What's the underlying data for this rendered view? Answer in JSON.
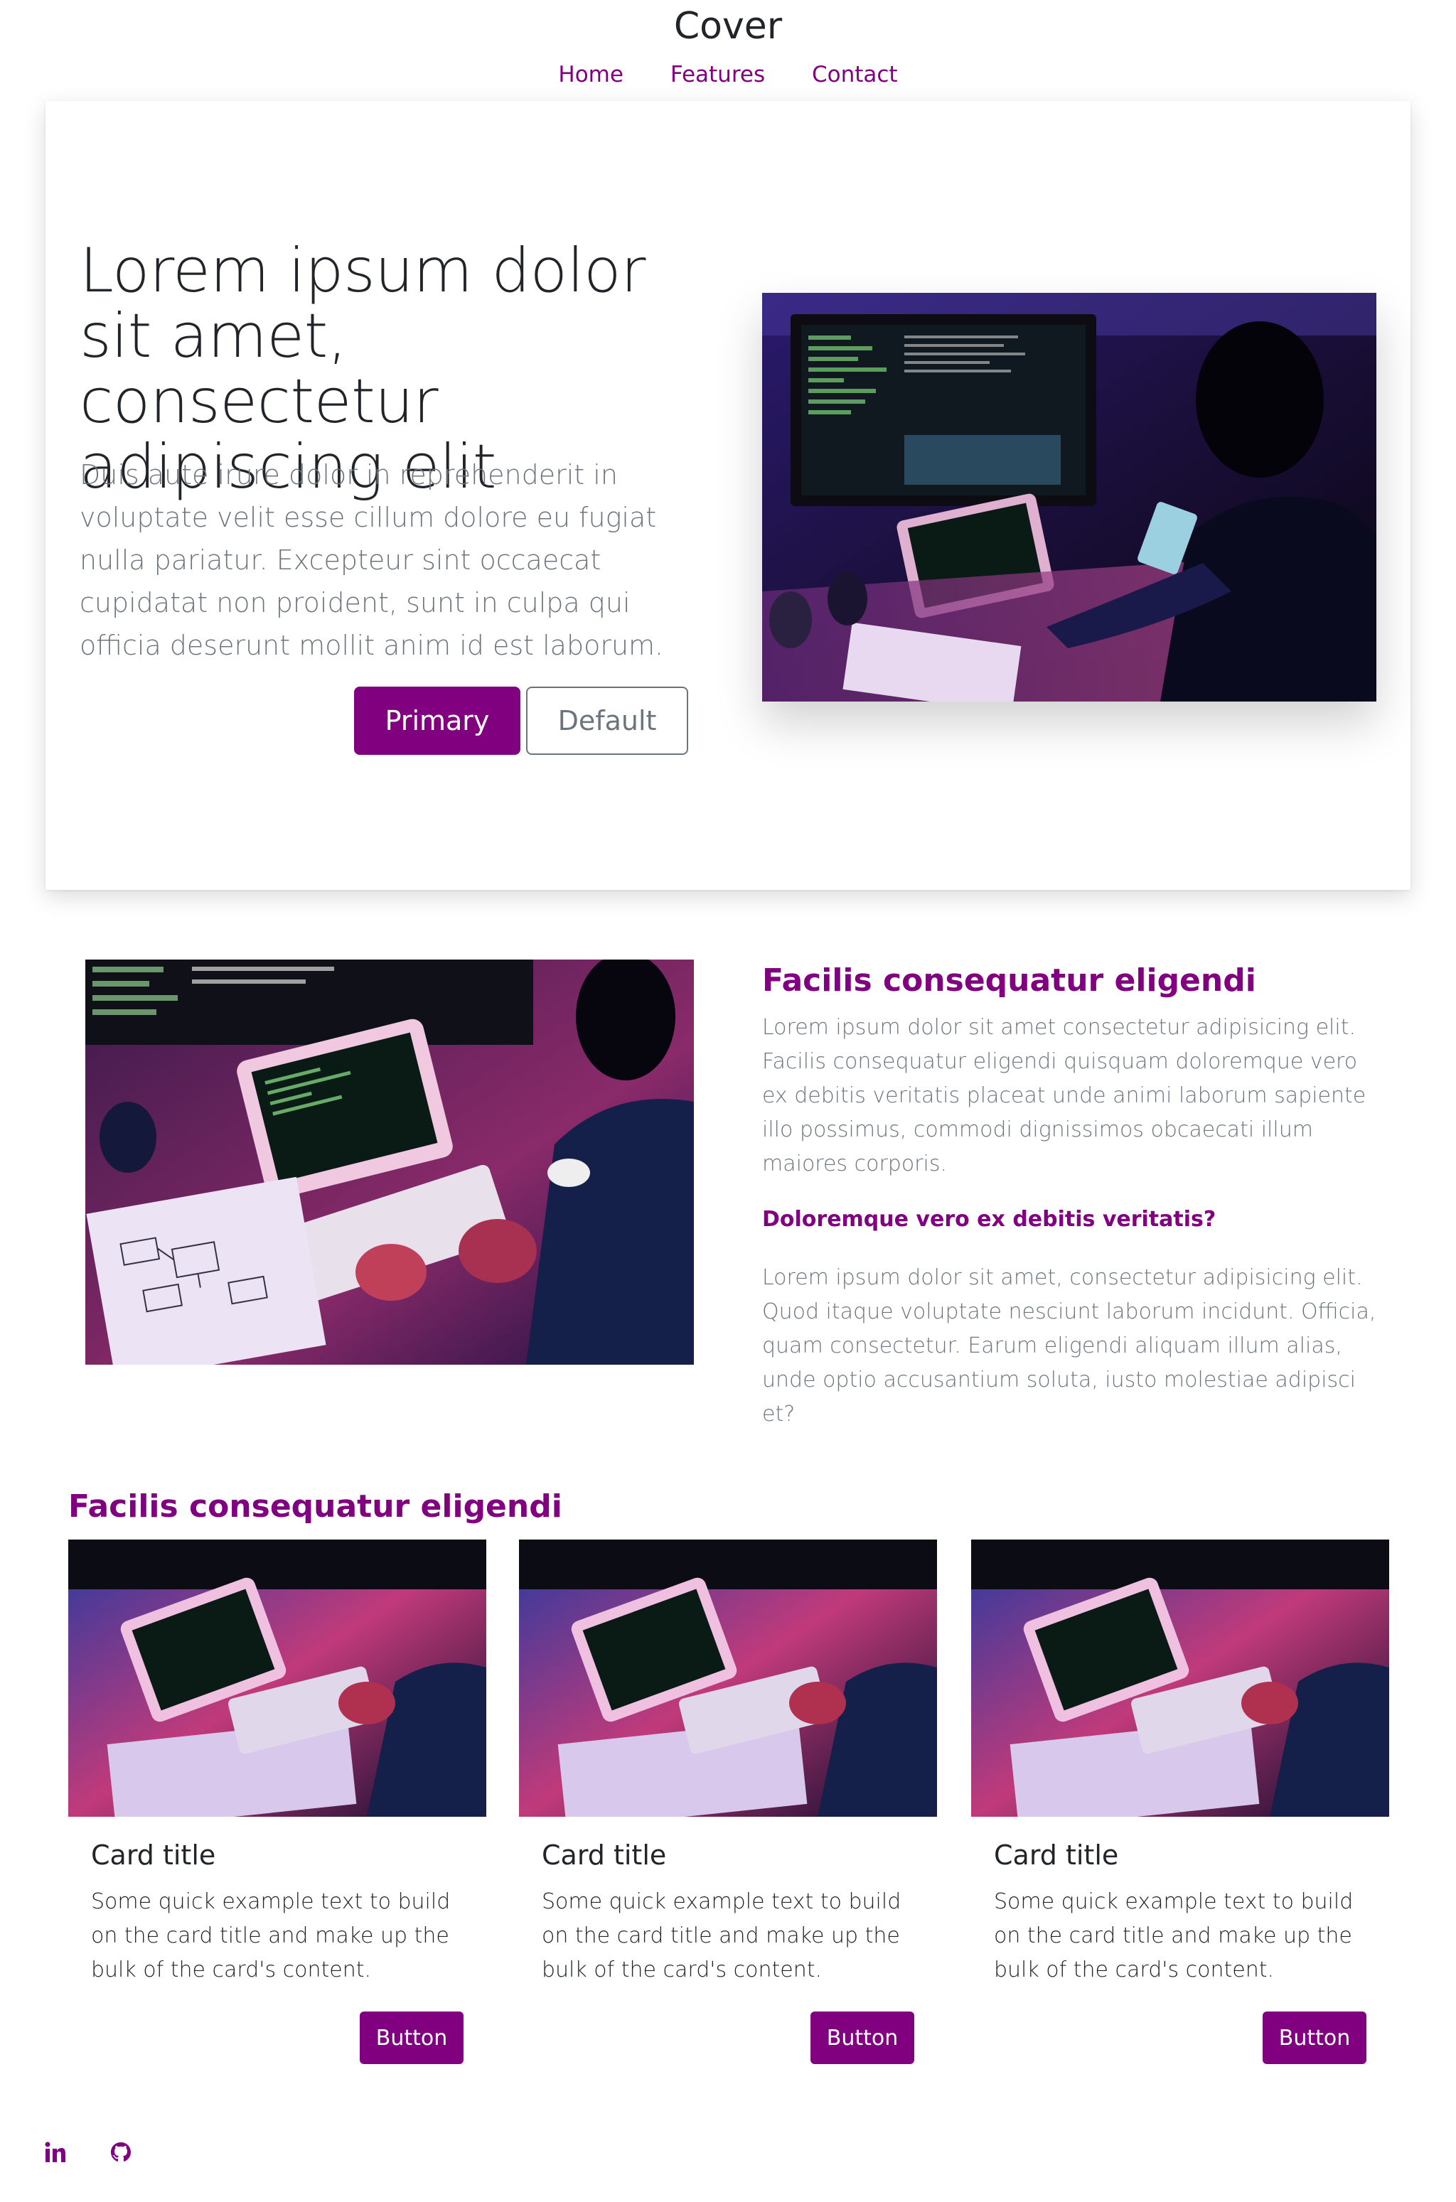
{
  "header": {
    "title": "Cover",
    "nav": [
      "Home",
      "Features",
      "Contact"
    ]
  },
  "hero": {
    "title": "Lorem ipsum dolor sit amet, consectetur adipiscing elit",
    "lead": "Duis aute irure dolor in reprehenderit in voluptate velit esse cillum dolore eu fugiat nulla pariatur. Excepteur sint occaecat cupidatat non proident, sunt in culpa qui officia deserunt mollit anim id est laborum.",
    "primary_label": "Primary",
    "default_label": "Default"
  },
  "feature": {
    "title": "Facilis consequatur eligendi",
    "paragraph1": "Lorem ipsum dolor sit amet consectetur adipisicing elit. Facilis consequatur eligendi quisquam doloremque vero ex debitis veritatis placeat unde animi laborum sapiente illo possimus, commodi dignissimos obcaecati illum maiores corporis.",
    "subheading": "Doloremque vero ex debitis veritatis?",
    "paragraph2": "Lorem ipsum dolor sit amet, consectetur adipisicing elit. Quod itaque voluptate nesciunt laborum incidunt. Officia, quam consectetur. Earum eligendi aliquam illum alias, unde optio accusantium soluta, iusto molestiae adipisci et?"
  },
  "cards_section": {
    "title": "Facilis consequatur eligendi",
    "cards": [
      {
        "title": "Card title",
        "text": "Some quick example text to build on the card title and make up the bulk of the card's content.",
        "button": "Button"
      },
      {
        "title": "Card title",
        "text": "Some quick example text to build on the card title and make up the bulk of the card's content.",
        "button": "Button"
      },
      {
        "title": "Card title",
        "text": "Some quick example text to build on the card title and make up the bulk of the card's content.",
        "button": "Button"
      }
    ]
  },
  "footer": {
    "icons": [
      "linkedin-icon",
      "github-icon"
    ]
  },
  "colors": {
    "accent": "#800080",
    "muted": "#6c757d",
    "text": "#212529"
  }
}
